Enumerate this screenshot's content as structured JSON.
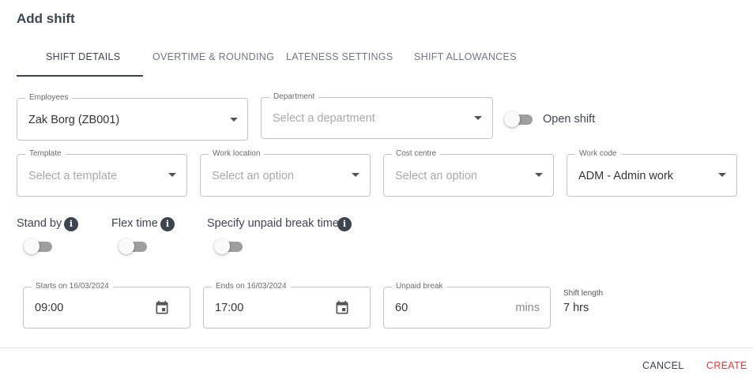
{
  "dialog": {
    "title": "Add shift"
  },
  "tabs": [
    {
      "label": "SHIFT DETAILS",
      "active": true
    },
    {
      "label": "OVERTIME & ROUNDING"
    },
    {
      "label": "LATENESS SETTINGS"
    },
    {
      "label": "SHIFT ALLOWANCES"
    }
  ],
  "employees": {
    "label": "Employees",
    "value": "Zak Borg (ZB001)"
  },
  "department": {
    "label": "Department",
    "placeholder": "Select a department"
  },
  "open_shift": {
    "label": "Open shift",
    "on": false
  },
  "template": {
    "label": "Template",
    "placeholder": "Select a template"
  },
  "work_location": {
    "label": "Work location",
    "placeholder": "Select an option"
  },
  "cost_centre": {
    "label": "Cost centre",
    "placeholder": "Select an option"
  },
  "work_code": {
    "label": "Work code",
    "value": "ADM - Admin work"
  },
  "toggles": {
    "stand_by": {
      "label": "Stand by",
      "on": false
    },
    "flex_time": {
      "label": "Flex time",
      "on": false
    },
    "unpaid_break": {
      "label": "Specify unpaid break time",
      "on": false
    }
  },
  "starts": {
    "label": "Starts on 16/03/2024",
    "value": "09:00"
  },
  "ends": {
    "label": "Ends on 16/03/2024",
    "value": "17:00"
  },
  "unpaid_break": {
    "label": "Unpaid break",
    "value": "60",
    "suffix": "mins"
  },
  "shift_length": {
    "label": "Shift length",
    "value": "7 hrs"
  },
  "actions": {
    "cancel": "CANCEL",
    "create": "CREATE"
  },
  "colors": {
    "primary_text": "#3d4650",
    "accent_red": "#e53935",
    "switch_off": "#9e9e9e"
  }
}
